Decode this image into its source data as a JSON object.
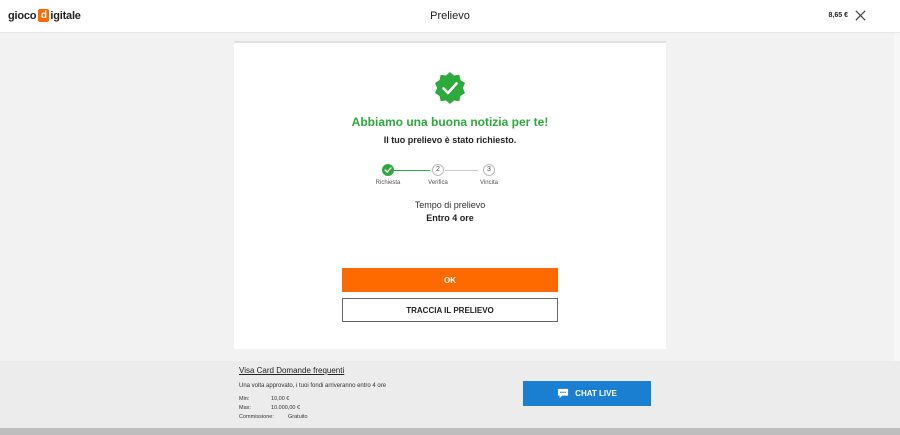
{
  "header": {
    "logo_pre": "gioco",
    "logo_letter": "d",
    "logo_post": "igitale",
    "title": "Prelievo",
    "balance": "8,65 €"
  },
  "card": {
    "headline": "Abbiamo una buona notizia per te!",
    "subline": "Il tuo prelievo è stato richiesto.",
    "steps": [
      {
        "num": "",
        "label": "Richiesta",
        "done": true
      },
      {
        "num": "2",
        "label": "Verifica",
        "done": false
      },
      {
        "num": "3",
        "label": "Vincita",
        "done": false
      }
    ],
    "time_label": "Tempo di prelievo",
    "time_value": "Entro 4 ore",
    "ok_label": "OK",
    "track_label": "TRACCIA IL PRELIEVO"
  },
  "footer": {
    "faq_link": "Visa Card Domande frequenti",
    "approve_text": "Una volta approvato, i tuoi fondi arriveranno entro 4 ore",
    "min_label": "Min:",
    "min_value": "10,00 €",
    "max_label": "Max:",
    "max_value": "10.000,00 €",
    "fee_label": "Commissione:",
    "fee_value": "Gratuito",
    "chat_label": "CHAT LIVE"
  },
  "colors": {
    "brand_orange": "#ff6a00",
    "success_green": "#2eaa3c",
    "chat_blue": "#1a7fd1"
  }
}
